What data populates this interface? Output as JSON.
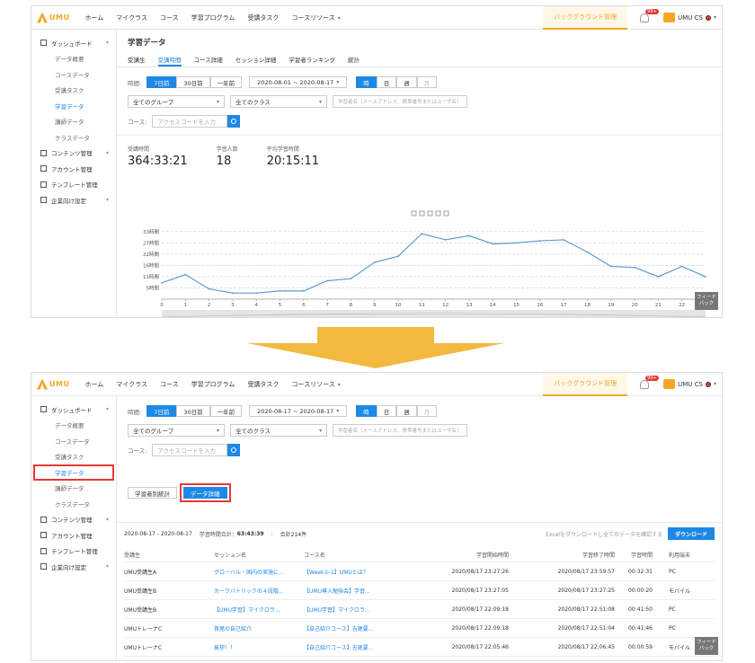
{
  "app": {
    "logo_text": "UMU",
    "nav": [
      "ホーム",
      "マイクラス",
      "コース",
      "学習プログラム",
      "受講タスク",
      "コースリソース"
    ],
    "bg_manage": "バックグラウンド管理",
    "badge": "99+",
    "user": "UMU CS"
  },
  "sidebar": {
    "items": [
      {
        "label": "ダッシュボード",
        "sub": false,
        "caret": true
      },
      {
        "label": "データ概要",
        "sub": true
      },
      {
        "label": "コースデータ",
        "sub": true
      },
      {
        "label": "受講タスク",
        "sub": true
      },
      {
        "label": "学習データ",
        "sub": true,
        "active": true
      },
      {
        "label": "講師データ",
        "sub": true
      },
      {
        "label": "クラスデータ",
        "sub": true
      },
      {
        "label": "コンテンツ管理",
        "sub": false,
        "caret": true
      },
      {
        "label": "アカウント管理",
        "sub": false
      },
      {
        "label": "テンプレート管理",
        "sub": false
      },
      {
        "label": "企業向け設定",
        "sub": false,
        "caret": true
      }
    ]
  },
  "screen1": {
    "title": "学習データ",
    "tabs": [
      "受講生",
      "受講時間",
      "コース詳細",
      "セッション詳細",
      "学習者ランキング",
      "統計"
    ],
    "period_label": "時間:",
    "period_buttons": [
      "7日前",
      "30日前",
      "一年前"
    ],
    "date_range": "2020-08-01 ~ 2020-08-17",
    "gran_buttons": [
      "時",
      "日",
      "週",
      "月"
    ],
    "group_select": "全てのグループ",
    "class_select": "全てのクラス",
    "learner_placeholder": "学習者名（メールアドレス、携帯番号またはユーザ名）",
    "course_label": "コース:",
    "course_placeholder": "アクセスコードを入力",
    "stats": [
      {
        "label": "受講時間",
        "value": "364:33:21"
      },
      {
        "label": "学習人数",
        "value": "18"
      },
      {
        "label": "平均学習時間",
        "value": "20:15:11"
      }
    ],
    "feedback": "フィードバック"
  },
  "screen2": {
    "period_label": "時間:",
    "period_buttons": [
      "7日前",
      "30日前",
      "一年前"
    ],
    "date_range": "2020-08-17 ~ 2020-08-17",
    "gran_buttons": [
      "時",
      "日",
      "週",
      "月"
    ],
    "group_select": "全てのグループ",
    "class_select": "全てのクラス",
    "learner_placeholder": "学習者名（メールアドレス、携帯番号またはユーザ名）",
    "course_label": "コース:",
    "course_placeholder": "アクセスコードを入力",
    "view_buttons": [
      "学習者別統計",
      "データ詳細"
    ],
    "summary_range": "2020-08-17 - 2020-08-17",
    "summary_total_label": "学習時間合計：",
    "summary_total": "63:43:39",
    "summary_count": "合計214件",
    "excel_text": "Excelをダウンロードし全てのデータを確認する",
    "download": "ダウンロード",
    "columns": [
      "受講生",
      "セッション名",
      "コース名",
      "学習開始時間",
      "学習終了時間",
      "学習時間",
      "利用端末"
    ],
    "rows": [
      [
        "UMU受講生A",
        "グローバル・国内の実施に...",
        "【Week①-1】UMUとは？",
        "2020/08/17 23:27:26",
        "2020/08/17 23:59:57",
        "00:32:31",
        "PC"
      ],
      [
        "UMU受講生B",
        "カークパトリックの４段階...",
        "【UMU導入勉強会】学習...",
        "2020/08/17 23:27:05",
        "2020/08/17 23:27:25",
        "00:00:20",
        "モバイル"
      ],
      [
        "UMU受講生B",
        "【UMU学習】マイクロラ...",
        "【UMU学習】マイクロラ...",
        "2020/08/17 22:09:18",
        "2020/08/17 22:51:08",
        "00:41:50",
        "PC"
      ],
      [
        "UMUトレーナC",
        "首尾の自己紹介",
        "【自己紹介コース】吉尾要...",
        "2020/08/17 22:09:18",
        "2020/08/17 22:51:04",
        "00:41:46",
        "PC"
      ],
      [
        "UMUトレーナC",
        "挨拶！！",
        "【自己紹介コース】吉尾要...",
        "2020/08/17 22:05:46",
        "2020/08/17 22:06:45",
        "00:00:59",
        "モバイル"
      ]
    ],
    "feedback": "フィードバック"
  },
  "chart_data": {
    "type": "line",
    "x": [
      0,
      1,
      2,
      3,
      4,
      5,
      6,
      7,
      8,
      9,
      10,
      11,
      12,
      13,
      14,
      15,
      16,
      17,
      18,
      19,
      20,
      21,
      22,
      23
    ],
    "series": [
      {
        "name": "受講時間",
        "values": [
          8,
          12,
          5,
          3,
          3,
          4,
          4,
          9,
          10,
          18,
          21,
          32,
          29,
          31,
          27,
          27.5,
          28.5,
          29,
          23,
          16,
          15.5,
          11,
          16,
          11
        ]
      }
    ],
    "y_ticks": [
      "5時間",
      "11時間",
      "16時間",
      "22時間",
      "27時間",
      "33時間"
    ],
    "ylim": [
      0,
      36
    ],
    "grid": true,
    "legend": "bottom-center",
    "color": "#5b9bd5"
  }
}
